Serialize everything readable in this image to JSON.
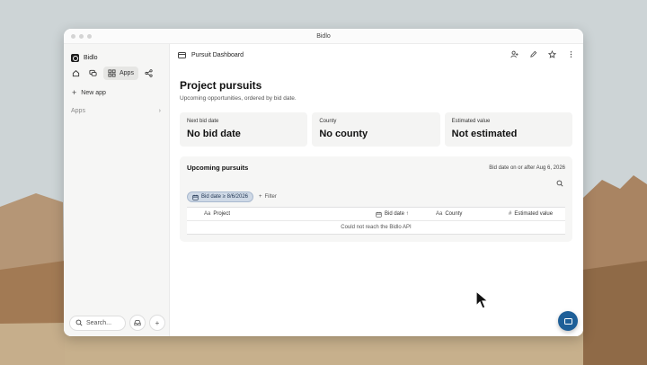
{
  "window": {
    "title": "Bidlo"
  },
  "sidebar": {
    "brand": "Bidlo",
    "nav": [
      {
        "icon": "home-icon"
      },
      {
        "icon": "chat-icon"
      },
      {
        "icon": "apps-grid-icon",
        "label": "Apps"
      },
      {
        "icon": "share-icon"
      }
    ],
    "new_app_label": "New app",
    "apps_group_label": "Apps",
    "search_placeholder": "Search..."
  },
  "header": {
    "title": "Pursuit Dashboard"
  },
  "page": {
    "title": "Project pursuits",
    "subtitle": "Upcoming opportunities, ordered by bid date."
  },
  "cards": [
    {
      "label": "Next bid date",
      "value": "No bid date"
    },
    {
      "label": "County",
      "value": "No county"
    },
    {
      "label": "Estimated value",
      "value": "Not estimated"
    }
  ],
  "panel": {
    "title": "Upcoming pursuits",
    "meta": "Bid date on or after Aug 6, 2026",
    "filter_chip": "Bid date ≥ 8/6/2026",
    "filter_button": "Filter",
    "columns": [
      {
        "icon": "Aa",
        "label": "Project"
      },
      {
        "icon": "calendar-icon",
        "label": "Bid date ↑"
      },
      {
        "icon": "Aa",
        "label": "County"
      },
      {
        "icon": "#",
        "label": "Estimated value"
      }
    ],
    "empty_message": "Could not reach the Bidlo API"
  },
  "colors": {
    "accent": "#1e5f98",
    "chip_bg": "#cfd9e6"
  }
}
